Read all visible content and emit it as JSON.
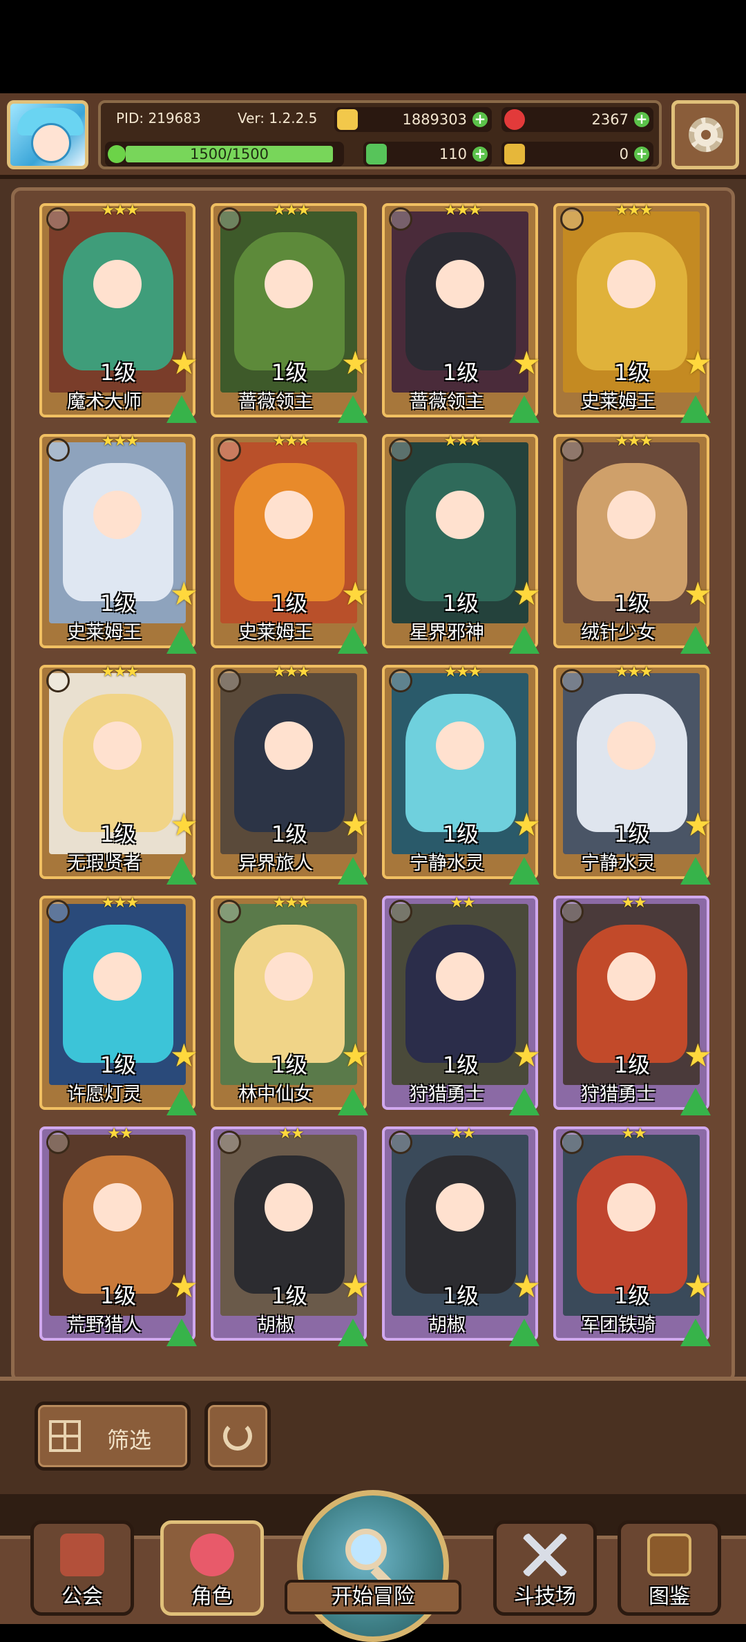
{
  "header": {
    "pid": "PID: 219683",
    "version": "Ver: 1.2.2.5",
    "gold": "1889303",
    "gems": "2367",
    "energy": "1500/1500",
    "energy_fraction": 1.0,
    "clover": "110",
    "keys": "0"
  },
  "colors": {
    "gold_frame": "#f0bf62",
    "purple_frame": "#d0a8ee",
    "plus_green": "#5bc24a"
  },
  "cards": [
    {
      "name": "魔术大师",
      "level": "1级",
      "rarity": "gold",
      "hair": "#3f9d7a",
      "bg": "#7a3d2a",
      "icon": "wrench-icon"
    },
    {
      "name": "蔷薇领主",
      "level": "1级",
      "rarity": "gold",
      "hair": "#5d8a3a",
      "bg": "#3e5a2a",
      "icon": "wrench-icon"
    },
    {
      "name": "蔷薇领主",
      "level": "1级",
      "rarity": "gold",
      "hair": "#2b2b33",
      "bg": "#4a2b3a",
      "icon": "wrench-icon"
    },
    {
      "name": "史莱姆王",
      "level": "1级",
      "rarity": "gold",
      "hair": "#e0b23a",
      "bg": "#c48a22",
      "icon": "wrench-icon"
    },
    {
      "name": "史莱姆王",
      "level": "1级",
      "rarity": "gold",
      "hair": "#dfe7f2",
      "bg": "#8ea3bd",
      "icon": "wrench-icon"
    },
    {
      "name": "史莱姆王",
      "level": "1级",
      "rarity": "gold",
      "hair": "#e88a2a",
      "bg": "#b9502a",
      "icon": "wrench-icon"
    },
    {
      "name": "星界邪神",
      "level": "1级",
      "rarity": "gold",
      "hair": "#2f6a5a",
      "bg": "#24423c",
      "icon": "wrench-icon"
    },
    {
      "name": "绒针少女",
      "level": "1级",
      "rarity": "gold",
      "hair": "#cfa06a",
      "bg": "#6a4a3a",
      "icon": "wrench-icon"
    },
    {
      "name": "无瑕贤者",
      "level": "1级",
      "rarity": "gold",
      "hair": "#f1d487",
      "bg": "#e9e0d0",
      "icon": "target-icon"
    },
    {
      "name": "异界旅人",
      "level": "1级",
      "rarity": "gold",
      "hair": "#2c3446",
      "bg": "#5a4a3a",
      "icon": "target-icon"
    },
    {
      "name": "宁静水灵",
      "level": "1级",
      "rarity": "gold",
      "hair": "#6fd0dd",
      "bg": "#2a5a6a",
      "icon": "target-icon"
    },
    {
      "name": "宁静水灵",
      "level": "1级",
      "rarity": "gold",
      "hair": "#dfe5ee",
      "bg": "#4a5566",
      "icon": "target-icon"
    },
    {
      "name": "许愿灯灵",
      "level": "1级",
      "rarity": "gold",
      "hair": "#3cc4d8",
      "bg": "#2a4a7a",
      "icon": "target-icon"
    },
    {
      "name": "林中仙女",
      "level": "1级",
      "rarity": "gold",
      "hair": "#f0d488",
      "bg": "#5a7a4a",
      "icon": "target-icon"
    },
    {
      "name": "狩猎勇士",
      "level": "1级",
      "rarity": "purple",
      "hair": "#2b2d4a",
      "bg": "#4a4a3a",
      "icon": "feather-icon"
    },
    {
      "name": "狩猎勇士",
      "level": "1级",
      "rarity": "purple",
      "hair": "#c24a2a",
      "bg": "#4a3a3a",
      "icon": "feather-icon"
    },
    {
      "name": "荒野猎人",
      "level": "1级",
      "rarity": "purple",
      "hair": "#c97a3a",
      "bg": "#5a3a2a",
      "icon": "feather-icon"
    },
    {
      "name": "胡椒",
      "level": "1级",
      "rarity": "purple",
      "hair": "#2c2c30",
      "bg": "#6a5a4a",
      "icon": "feather-icon"
    },
    {
      "name": "胡椒",
      "level": "1级",
      "rarity": "purple",
      "hair": "#2c2c30",
      "bg": "#3a4a5a",
      "icon": "feather-icon"
    },
    {
      "name": "军团铁骑",
      "level": "1级",
      "rarity": "purple",
      "hair": "#c0452e",
      "bg": "#3a4a5a",
      "icon": "feather-icon"
    }
  ],
  "filter": {
    "label": "筛选"
  },
  "nav": {
    "guild": "公会",
    "character": "角色",
    "adventure": "开始冒险",
    "arena": "斗技场",
    "codex": "图鉴"
  }
}
